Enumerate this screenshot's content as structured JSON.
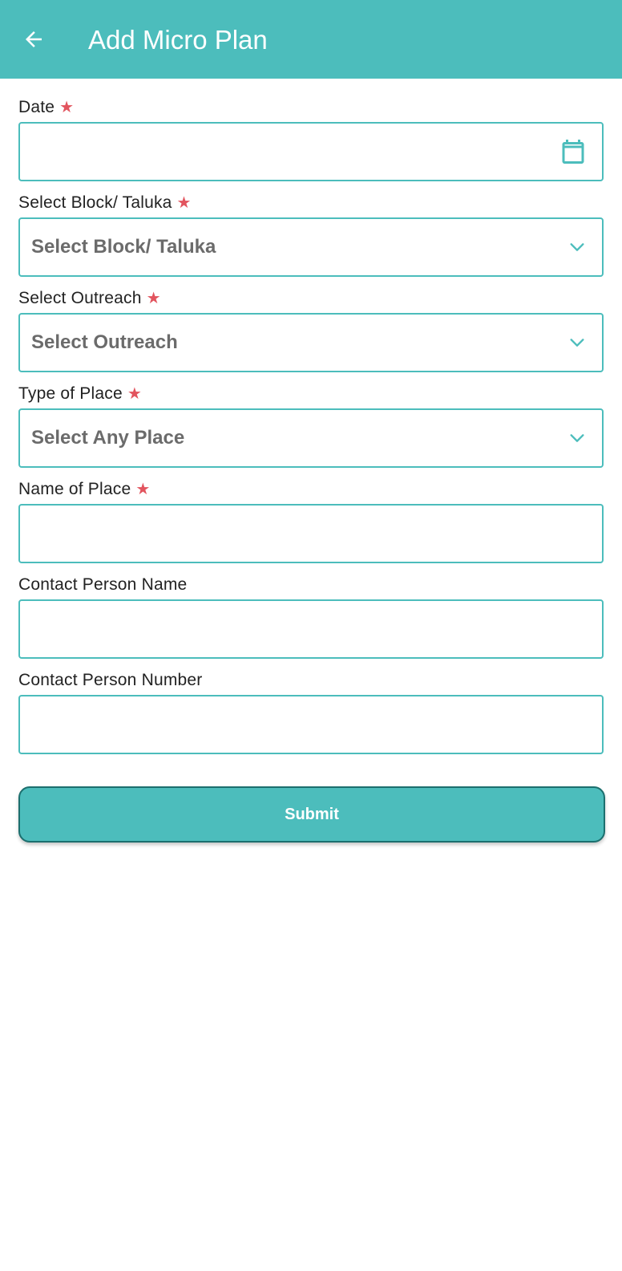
{
  "appbar": {
    "title": "Add Micro Plan",
    "back_icon": "arrow-left-icon",
    "color": "#4cbdbc"
  },
  "form": {
    "required_marker": "★",
    "fields": [
      {
        "label": "Date",
        "required": true,
        "type": "date",
        "value": "",
        "icon": "calendar-icon"
      },
      {
        "label": "Select Block/ Taluka",
        "required": true,
        "type": "select",
        "selected": "Select Block/ Taluka"
      },
      {
        "label": "Select Outreach",
        "required": true,
        "type": "select",
        "selected": "Select Outreach"
      },
      {
        "label": "Type of Place",
        "required": true,
        "type": "select",
        "selected": "Select Any Place"
      },
      {
        "label": "Name of Place",
        "required": true,
        "type": "text",
        "value": ""
      },
      {
        "label": "Contact Person Name",
        "required": false,
        "type": "text",
        "value": ""
      },
      {
        "label": "Contact Person Number",
        "required": false,
        "type": "text",
        "value": ""
      }
    ]
  },
  "submit": {
    "label": "Submit"
  },
  "colors": {
    "accent": "#4cbdbc",
    "required": "#e2545e",
    "button_border": "#1c6f6e"
  }
}
